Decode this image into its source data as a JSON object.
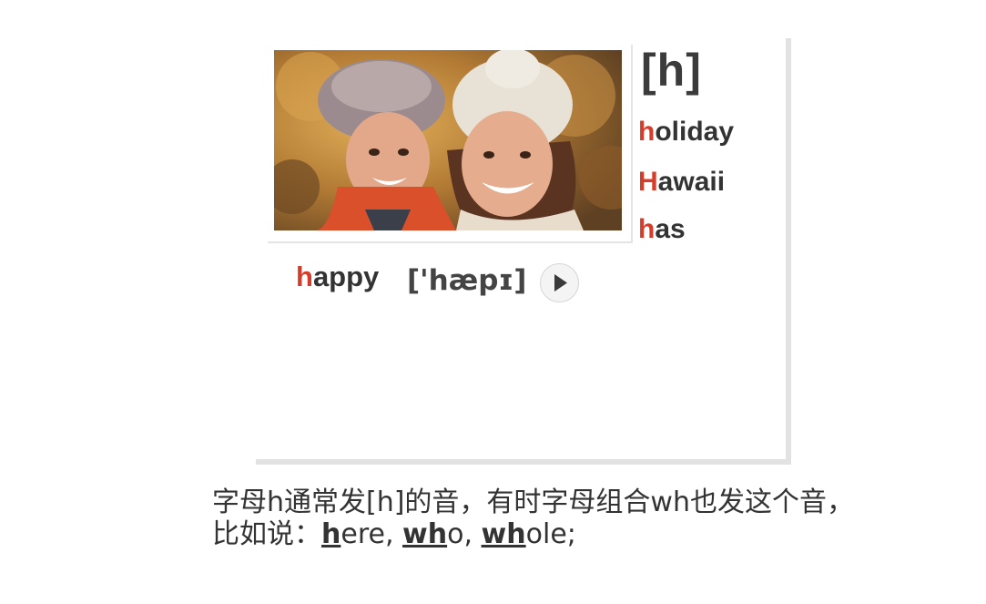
{
  "lesson": {
    "phonetic_symbol": "[h]",
    "words": [
      {
        "first": "h",
        "rest": "oliday"
      },
      {
        "first": "H",
        "rest": "awaii"
      },
      {
        "first": "h",
        "rest": "as"
      }
    ],
    "example": {
      "first": "h",
      "rest": "appy",
      "ipa": "['hæpɪ]"
    },
    "play_icon": "play-icon"
  },
  "description": {
    "line1": "字母h通常发[h]的音，有时字母组合wh也发这个音，",
    "line2_prefix": "比如说：",
    "examples": [
      {
        "bold": "h",
        "rest": "ere, "
      },
      {
        "bold": "wh",
        "rest": "o, "
      },
      {
        "bold": "wh",
        "rest": "ole;"
      }
    ]
  },
  "colors": {
    "accent": "#d63c2a",
    "text": "#333333",
    "shadow": "#e2e2e2"
  }
}
